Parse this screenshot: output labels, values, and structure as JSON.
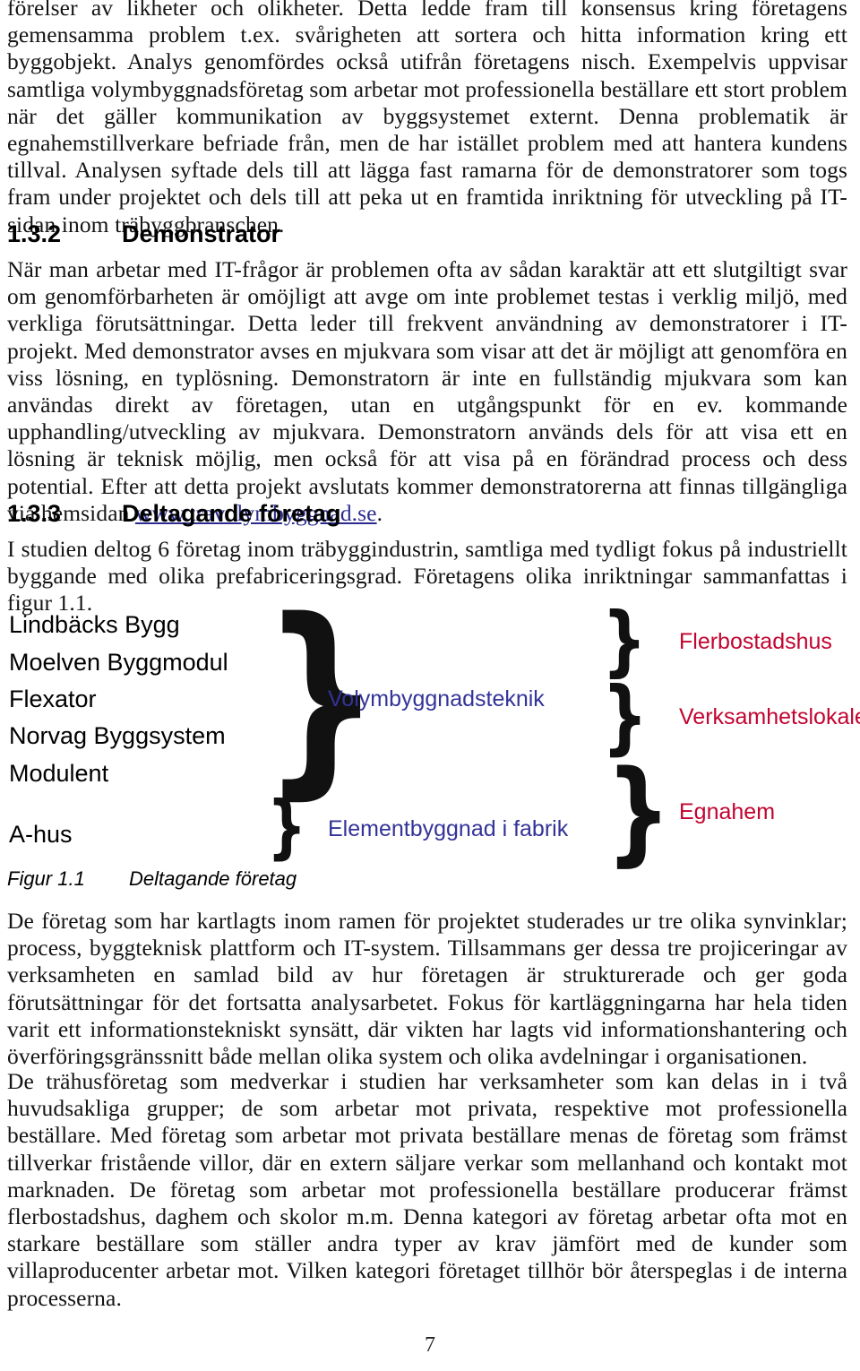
{
  "document": {
    "page_number": "7"
  },
  "paragraphs": {
    "continued_top": "förelser av likheter och olikheter. Detta ledde fram till konsensus kring företagens gemensamma problem t.ex. svårigheten att sortera och hitta information kring ett byggobjekt. Analys genomfördes också utifrån företagens nisch. Exempelvis uppvisar samtliga volymbyggnadsföretag som arbetar mot professionella beställare ett stort problem när det gäller kommunikation av byggsystemet externt. Denna problematik är egnahemstillverkare befriade från, men de har istället problem med att hantera kundens tillval. Analysen syftade dels till att lägga fast ramarna för de demonstratorer som togs fram under projektet och dels till att peka ut en framtida inriktning för utveckling på IT-sidan inom träbyggbranschen.",
    "demonstrator_body_before_link": "När man arbetar med IT-frågor är problemen ofta av sådan karaktär att ett slutgiltigt svar om genomförbarheten är omöjligt att avge om inte problemet testas i verklig miljö, med verkliga förutsättningar. Detta leder till frekvent användning av demonstratorer i IT-projekt. Med demonstrator avses en mjukvara som visar att det är möjligt att genomföra en viss lösning, en typlösning. Demonstratorn är inte en fullständig mjukvara som kan användas direkt av företagen, utan en utgångspunkt för en ev. kommande upphandling/utveckling av mjukvara. Demonstratorn används dels för att visa ett en lösning är teknisk möjlig, men också för att visa på en förändrad process och dess potential. Efter att detta projekt avslutats kommer demonstratorerna att finnas tillgängliga via hemsidan ",
    "demonstrator_link_text": "www.travolymbyggnad.se",
    "demonstrator_body_after_link": ".",
    "deltagande_intro": "I studien deltog 6 företag inom träbyggindustrin, samtliga med tydligt fokus på industriellt byggande med olika prefabriceringsgrad. Företagens olika inriktningar sammanfattas i figur 1.1.",
    "after_figure_1": "De företag som har kartlagts inom ramen för projektet studerades ur tre olika synvinklar; process, byggteknisk plattform och IT-system. Tillsammans ger dessa tre projiceringar av verksamheten en samlad bild av hur företagen är strukturerade och ger goda förutsättningar för det fortsatta analysarbetet. Fokus för kartläggningarna har hela tiden varit ett informationstekniskt synsätt, där vikten har lagts vid informationshantering och överföringsgränssnitt både mellan olika system och olika avdelningar i organisationen.",
    "after_figure_2": "De trähusföretag som medverkar i studien har verksamheter som kan delas in i två huvudsakliga grupper; de som arbetar mot privata, respektive mot professionella beställare. Med företag som arbetar mot privata beställare menas de företag som främst tillverkar fristående villor, där en extern säljare verkar som mellanhand och kontakt mot marknaden. De företag som arbetar mot professionella beställare producerar främst flerbostadshus, daghem och skolor m.m. Denna kategori av företag arbetar ofta mot en starkare beställare som ställer andra typer av krav jämfört med de kunder som villaproducenter arbetar mot. Vilken kategori företaget tillhör bör återspeglas i de interna processerna."
  },
  "headings": {
    "demonstrator": {
      "number": "1.3.2",
      "title": "Demonstrator"
    },
    "deltagande": {
      "number": "1.3.3",
      "title": "Deltagande företag"
    }
  },
  "figure": {
    "caption_number": "Figur 1.1",
    "caption_title": "Deltagande företag",
    "companies": [
      "Lindbäcks Bygg",
      "Moelven Byggmodul",
      "Flexator",
      "Norvag Byggsystem",
      "Modulent",
      "A-hus"
    ],
    "technique_labels": [
      "Volymbyggnadsteknik",
      "Elementbyggnad i fabrik"
    ],
    "market_labels": [
      "Flerbostadshus",
      "Verksamhetslokaler",
      "Egnahem"
    ],
    "brace_glyph": "}",
    "colors": {
      "technique": "#333399",
      "market": "#c20430",
      "brace": "#111111"
    }
  }
}
